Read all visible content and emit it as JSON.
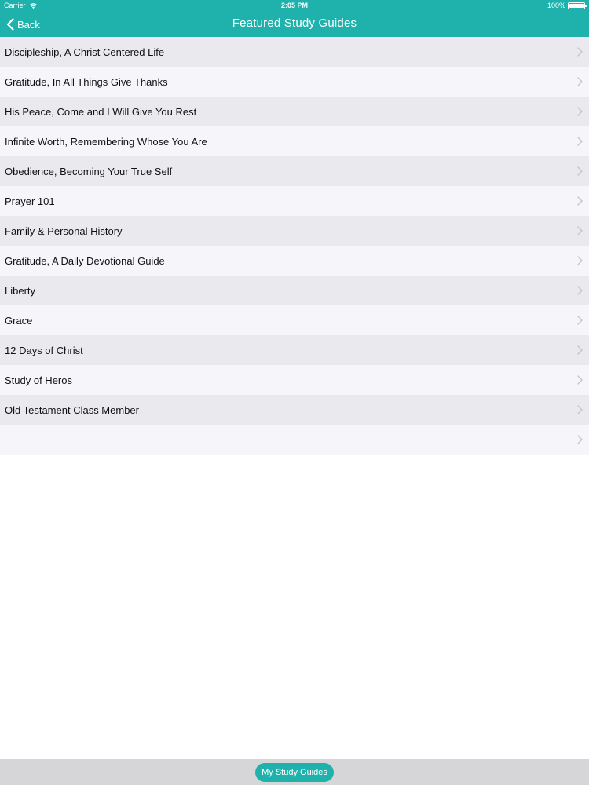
{
  "status_bar": {
    "carrier": "Carrier",
    "time": "2:05 PM",
    "battery": "100%"
  },
  "nav": {
    "back_label": "Back",
    "title": "Featured Study Guides"
  },
  "guides": [
    {
      "label": "Discipleship, A Christ Centered Life"
    },
    {
      "label": "Gratitude, In All Things Give Thanks"
    },
    {
      "label": "His Peace, Come and I Will Give You Rest"
    },
    {
      "label": "Infinite Worth, Remembering Whose You Are"
    },
    {
      "label": "Obedience, Becoming Your True Self"
    },
    {
      "label": "Prayer 101"
    },
    {
      "label": "Family & Personal History"
    },
    {
      "label": "Gratitude, A Daily Devotional Guide"
    },
    {
      "label": "Liberty"
    },
    {
      "label": "Grace"
    },
    {
      "label": "12 Days of Christ"
    },
    {
      "label": "Study of Heros"
    },
    {
      "label": "Old Testament Class Member"
    },
    {
      "label": ""
    }
  ],
  "toolbar": {
    "my_study_guides_label": "My Study Guides"
  },
  "colors": {
    "accent": "#1fb2ac",
    "row_odd": "#e9e9ee",
    "row_even": "#f6f6fa",
    "toolbar_bg": "#d6d6d8"
  },
  "icons": {
    "back": "chevron-left-icon",
    "row": "chevron-right-icon",
    "wifi": "wifi-icon",
    "battery": "battery-icon"
  }
}
